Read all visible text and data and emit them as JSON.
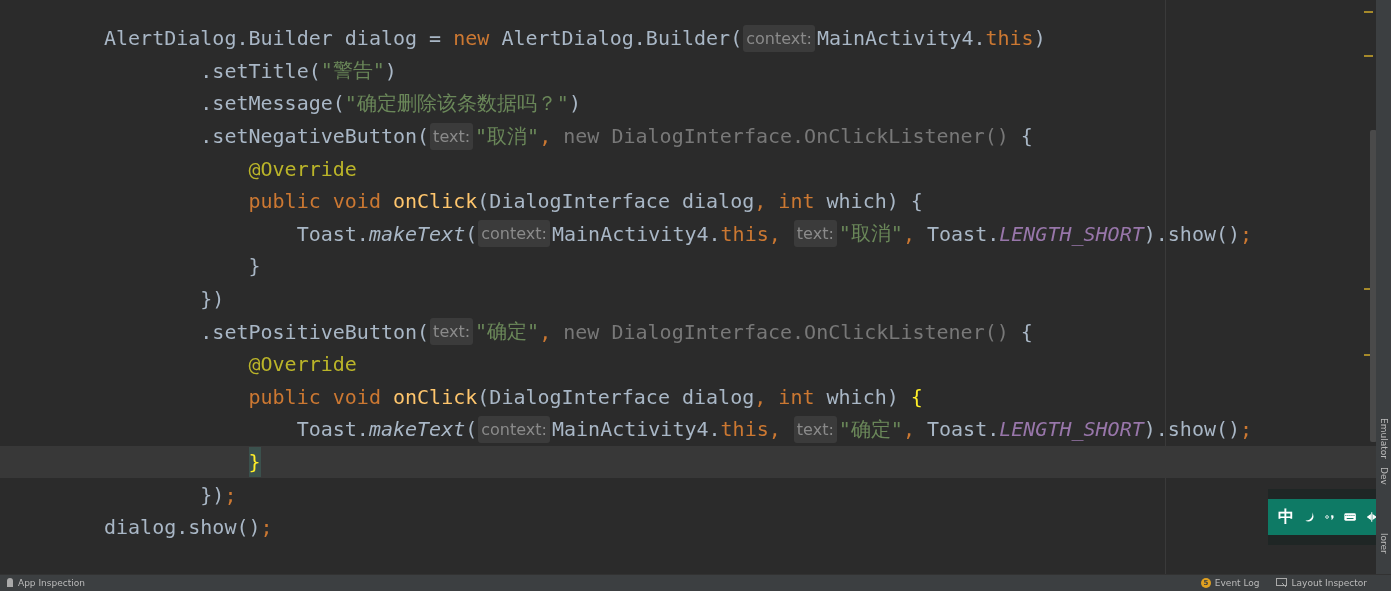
{
  "editor": {
    "lines": [
      {
        "current": false,
        "tokens": [
          {
            "text": "AlertDialog.Builder dialog = ",
            "kind": "plain"
          },
          {
            "text": "new",
            "kind": "keyword"
          },
          {
            "text": " AlertDialog.Builder(",
            "kind": "plain"
          },
          {
            "text": "context:",
            "kind": "hint"
          },
          {
            "text": "MainActivity4.",
            "kind": "plain"
          },
          {
            "text": "this",
            "kind": "keyword"
          },
          {
            "text": ")",
            "kind": "plain"
          }
        ]
      },
      {
        "current": false,
        "tokens": [
          {
            "text": "        .setTitle(",
            "kind": "plain"
          },
          {
            "text": "\"警告\"",
            "kind": "string"
          },
          {
            "text": ")",
            "kind": "plain"
          }
        ]
      },
      {
        "current": false,
        "tokens": [
          {
            "text": "        .setMessage(",
            "kind": "plain"
          },
          {
            "text": "\"确定删除该条数据吗？\"",
            "kind": "string"
          },
          {
            "text": ")",
            "kind": "plain"
          }
        ]
      },
      {
        "current": false,
        "tokens": [
          {
            "text": "        .setNegativeButton(",
            "kind": "plain"
          },
          {
            "text": "text:",
            "kind": "hint"
          },
          {
            "text": "\"取消\"",
            "kind": "string"
          },
          {
            "text": ", ",
            "kind": "keyword"
          },
          {
            "text": "new DialogInterface.OnClickListener()",
            "kind": "faded"
          },
          {
            "text": " {",
            "kind": "plain"
          }
        ]
      },
      {
        "current": false,
        "tokens": [
          {
            "text": "            @Override",
            "kind": "annotation"
          }
        ]
      },
      {
        "current": false,
        "tokens": [
          {
            "text": "            public void ",
            "kind": "keyword"
          },
          {
            "text": "onClick",
            "kind": "method"
          },
          {
            "text": "(DialogInterface dialog",
            "kind": "plain"
          },
          {
            "text": ", ",
            "kind": "keyword"
          },
          {
            "text": "int ",
            "kind": "keyword"
          },
          {
            "text": "which) {",
            "kind": "plain"
          }
        ]
      },
      {
        "current": false,
        "tokens": [
          {
            "text": "                Toast.",
            "kind": "plain"
          },
          {
            "text": "makeText",
            "kind": "italic"
          },
          {
            "text": "(",
            "kind": "plain"
          },
          {
            "text": "context:",
            "kind": "hint"
          },
          {
            "text": "MainActivity4.",
            "kind": "plain"
          },
          {
            "text": "this",
            "kind": "keyword"
          },
          {
            "text": ", ",
            "kind": "keyword"
          },
          {
            "text": "text:",
            "kind": "hint"
          },
          {
            "text": "\"取消\"",
            "kind": "string"
          },
          {
            "text": ", ",
            "kind": "keyword"
          },
          {
            "text": "Toast.",
            "kind": "plain"
          },
          {
            "text": "LENGTH_SHORT",
            "kind": "constant"
          },
          {
            "text": ").show()",
            "kind": "plain"
          },
          {
            "text": ";",
            "kind": "keyword"
          }
        ]
      },
      {
        "current": false,
        "tokens": [
          {
            "text": "            }",
            "kind": "plain"
          }
        ]
      },
      {
        "current": false,
        "tokens": [
          {
            "text": "        })",
            "kind": "plain"
          }
        ]
      },
      {
        "current": false,
        "tokens": [
          {
            "text": "        .setPositiveButton(",
            "kind": "plain"
          },
          {
            "text": "text:",
            "kind": "hint"
          },
          {
            "text": "\"确定\"",
            "kind": "string"
          },
          {
            "text": ", ",
            "kind": "keyword"
          },
          {
            "text": "new DialogInterface.OnClickListener()",
            "kind": "faded"
          },
          {
            "text": " {",
            "kind": "plain"
          }
        ]
      },
      {
        "current": false,
        "tokens": [
          {
            "text": "            @Override",
            "kind": "annotation"
          }
        ]
      },
      {
        "current": false,
        "tokens": [
          {
            "text": "            public void ",
            "kind": "keyword"
          },
          {
            "text": "onClick",
            "kind": "method"
          },
          {
            "text": "(DialogInterface dialog",
            "kind": "plain"
          },
          {
            "text": ", ",
            "kind": "keyword"
          },
          {
            "text": "int ",
            "kind": "keyword"
          },
          {
            "text": "which) ",
            "kind": "plain"
          },
          {
            "text": "{",
            "kind": "brace"
          }
        ]
      },
      {
        "current": false,
        "tokens": [
          {
            "text": "                Toast.",
            "kind": "plain"
          },
          {
            "text": "makeText",
            "kind": "italic"
          },
          {
            "text": "(",
            "kind": "plain"
          },
          {
            "text": "context:",
            "kind": "hint"
          },
          {
            "text": "MainActivity4.",
            "kind": "plain"
          },
          {
            "text": "this",
            "kind": "keyword"
          },
          {
            "text": ", ",
            "kind": "keyword"
          },
          {
            "text": "text:",
            "kind": "hint"
          },
          {
            "text": "\"确定\"",
            "kind": "string"
          },
          {
            "text": ", ",
            "kind": "keyword"
          },
          {
            "text": "Toast.",
            "kind": "plain"
          },
          {
            "text": "LENGTH_SHORT",
            "kind": "constant"
          },
          {
            "text": ").show()",
            "kind": "plain"
          },
          {
            "text": ";",
            "kind": "keyword"
          }
        ]
      },
      {
        "current": true,
        "tokens": [
          {
            "text": "            }",
            "kind": "brace-caret"
          }
        ]
      },
      {
        "current": false,
        "tokens": [
          {
            "text": "        })",
            "kind": "plain"
          },
          {
            "text": ";",
            "kind": "keyword"
          }
        ]
      },
      {
        "current": false,
        "tokens": [
          {
            "text": "dialog.show()",
            "kind": "plain"
          },
          {
            "text": ";",
            "kind": "keyword"
          }
        ]
      }
    ]
  },
  "side_tabs": [
    {
      "label": "Emulator"
    },
    {
      "label": "Dev"
    },
    {
      "label": "lorer"
    }
  ],
  "ime_toolbar": {
    "mode": "中"
  },
  "status_bar": {
    "left": [
      {
        "label": "App Inspection"
      }
    ],
    "event_log": {
      "count": "5",
      "label": "Event Log"
    },
    "layout_inspector": {
      "label": "Layout Inspector"
    }
  }
}
